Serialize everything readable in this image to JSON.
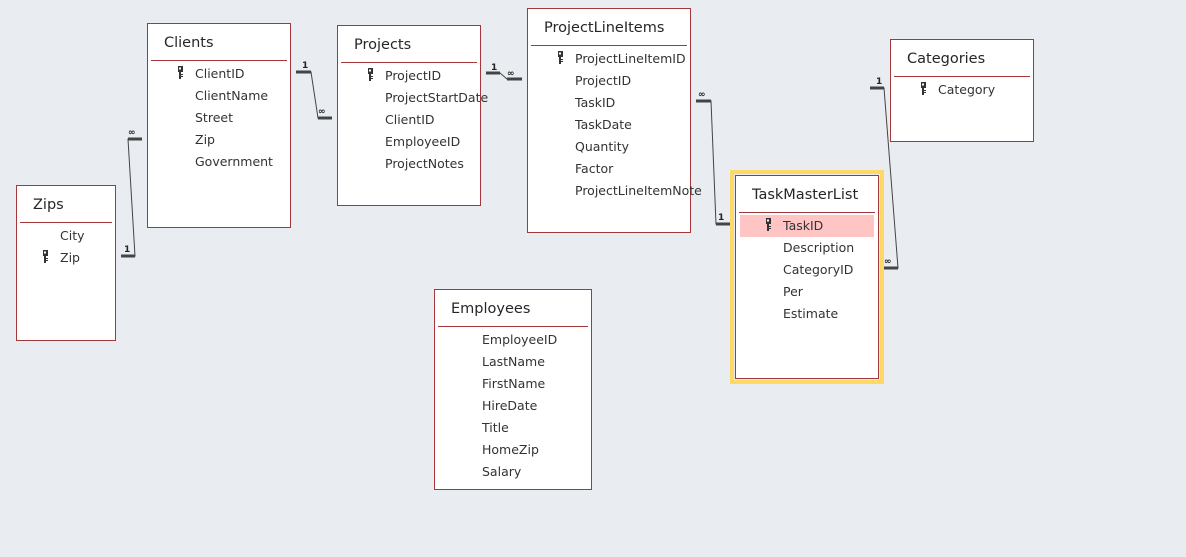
{
  "tables": {
    "zips": {
      "title": "Zips",
      "fields": [
        {
          "name": "City",
          "pk": false
        },
        {
          "name": "Zip",
          "pk": true
        }
      ]
    },
    "clients": {
      "title": "Clients",
      "fields": [
        {
          "name": "ClientID",
          "pk": true
        },
        {
          "name": "ClientName",
          "pk": false
        },
        {
          "name": "Street",
          "pk": false
        },
        {
          "name": "Zip",
          "pk": false
        },
        {
          "name": "Government",
          "pk": false
        }
      ]
    },
    "projects": {
      "title": "Projects",
      "fields": [
        {
          "name": "ProjectID",
          "pk": true
        },
        {
          "name": "ProjectStartDate",
          "pk": false
        },
        {
          "name": "ClientID",
          "pk": false
        },
        {
          "name": "EmployeeID",
          "pk": false
        },
        {
          "name": "ProjectNotes",
          "pk": false
        }
      ]
    },
    "projectlineitems": {
      "title": "ProjectLineItems",
      "fields": [
        {
          "name": "ProjectLineItemID",
          "pk": true
        },
        {
          "name": "ProjectID",
          "pk": false
        },
        {
          "name": "TaskID",
          "pk": false
        },
        {
          "name": "TaskDate",
          "pk": false
        },
        {
          "name": "Quantity",
          "pk": false
        },
        {
          "name": "Factor",
          "pk": false
        },
        {
          "name": "ProjectLineItemNote",
          "pk": false
        }
      ]
    },
    "taskmasterlist": {
      "title": "TaskMasterList",
      "selected": true,
      "fields": [
        {
          "name": "TaskID",
          "pk": true,
          "highlighted": true
        },
        {
          "name": "Description",
          "pk": false
        },
        {
          "name": "CategoryID",
          "pk": false
        },
        {
          "name": "Per",
          "pk": false
        },
        {
          "name": "Estimate",
          "pk": false
        }
      ]
    },
    "categories": {
      "title": "Categories",
      "fields": [
        {
          "name": "Category",
          "pk": true
        }
      ]
    },
    "employees": {
      "title": "Employees",
      "fields": [
        {
          "name": "EmployeeID",
          "pk": false
        },
        {
          "name": "LastName",
          "pk": false
        },
        {
          "name": "FirstName",
          "pk": false
        },
        {
          "name": "HireDate",
          "pk": false
        },
        {
          "name": "Title",
          "pk": false
        },
        {
          "name": "HomeZip",
          "pk": false
        },
        {
          "name": "Salary",
          "pk": false
        }
      ]
    }
  },
  "relationships": [
    {
      "from": "Zips.Zip",
      "to": "Clients.Zip",
      "one_label": "1",
      "many_label": "∞"
    },
    {
      "from": "Clients.ClientID",
      "to": "Projects.ClientID",
      "one_label": "1",
      "many_label": "∞"
    },
    {
      "from": "Projects.ProjectID",
      "to": "ProjectLineItems.ProjectID",
      "one_label": "1",
      "many_label": "∞"
    },
    {
      "from": "TaskMasterList.TaskID",
      "to": "ProjectLineItems.TaskID",
      "one_label": "1",
      "many_label": "∞"
    },
    {
      "from": "Categories.Category",
      "to": "TaskMasterList.CategoryID",
      "one_label": "1",
      "many_label": "∞"
    }
  ],
  "colors": {
    "table_border": "#a4373a",
    "selected_outline": "#ffd966",
    "highlight_row": "#ffc4c4",
    "background": "#e9edf1"
  }
}
